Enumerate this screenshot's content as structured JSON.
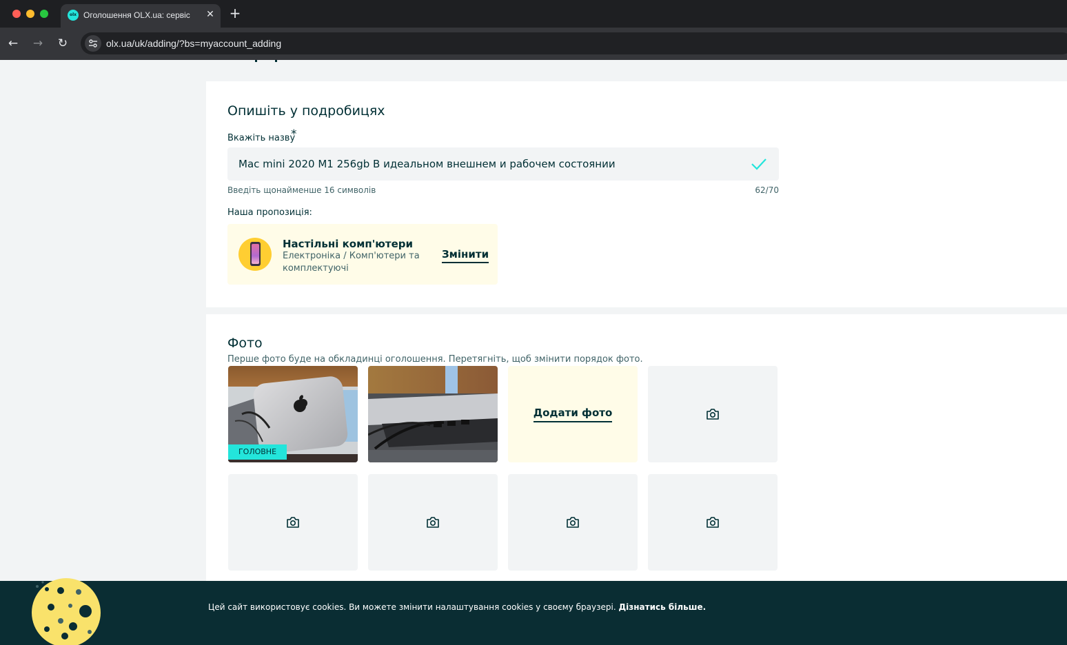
{
  "browser": {
    "tab_title": "Оголошення OLX.ua: сервіс",
    "tab_favicon_text": "olx",
    "new_tab_symbol": "+",
    "close_symbol": "✕",
    "url": "olx.ua/uk/adding/?bs=myaccount_adding",
    "back_symbol": "←",
    "forward_symbol": "→",
    "reload_symbol": "↻"
  },
  "describe_section": {
    "title": "Опишіть у подробицях",
    "name_label": "Вкажіть назву",
    "required_mark": "*",
    "name_value": "Mac mini 2020 M1 256gb В идеальном внешнем и рабочем состоянии",
    "hint": "Введіть щонайменше 16 символів",
    "counter": "62/70",
    "proposal_label": "Наша пропозиція:",
    "category": {
      "name": "Настільні комп'ютери",
      "path": "Електроніка / Комп'ютери та комплектуючі",
      "change_label": "Змінити"
    }
  },
  "photo_section": {
    "title": "Фото",
    "subtitle": "Перше фото буде на обкладинці оголошення. Перетягніть, щоб змінити порядок фото.",
    "main_badge": "ГОЛОВНЕ",
    "add_photo_label": "Додати фото"
  },
  "cookie_banner": {
    "text": "Цей сайт використовує cookies. Ви можете змінити налаштування cookies у своєму браузері.",
    "link": "Дізнатись більше."
  },
  "colors": {
    "brand_dark": "#002f34",
    "brand_teal": "#23e5db",
    "cookie_bg": "#0a2d33",
    "highlight_bg": "#fffce8"
  }
}
